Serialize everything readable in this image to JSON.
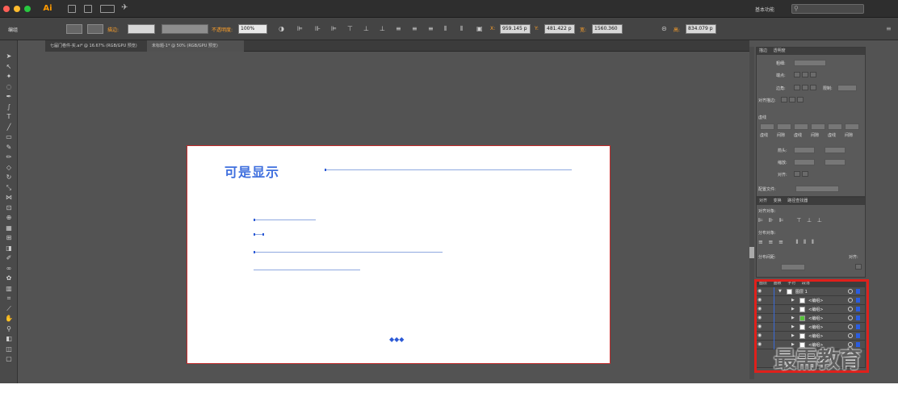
{
  "app": {
    "logo": "Ai",
    "workspace": "基本功能",
    "accent": "#ff9a00"
  },
  "controlbar": {
    "object_type": "编组",
    "stroke_label": "描边:",
    "opacity_label": "不透明度:",
    "opacity_value": "100%",
    "x_label": "X:",
    "x_value": "959.145 p",
    "y_label": "Y:",
    "y_value": "481.422 p",
    "w_label": "宽:",
    "w_value": "1560.360",
    "h_label": "高:",
    "h_value": "834.079 p"
  },
  "tabs": [
    {
      "label": "七届门卷件-实.ai* @ 16.67% (RGB/GPU 预览)"
    },
    {
      "label": "未标题-1* @ 50% (RGB/GPU 预览)"
    }
  ],
  "artboard": {
    "title": "可是显示",
    "dots": "◆◆◆",
    "border_color": "#c32b2b",
    "guide_color": "#8fa9e0"
  },
  "stroke_panel": {
    "tabs": [
      "描边",
      "透明度"
    ],
    "weight_label": "粗细:",
    "cap_label": "端点:",
    "corner_label": "边角:",
    "limit_label": "限制:",
    "align_label": "对齐描边:",
    "dashed_label": "虚线",
    "dash_fields": [
      "虚线",
      "间隙",
      "虚线",
      "间隙",
      "虚线",
      "间隙"
    ],
    "arrow_label": "箭头:",
    "scale_label": "缩放:",
    "align2_label": "对齐:",
    "profile_label": "配置文件:"
  },
  "align_panel": {
    "tabs": [
      "对齐",
      "变换",
      "路径查找器"
    ],
    "align_objects": "对齐对象:",
    "distribute_objects": "分布对象:",
    "distribute_spacing": "分布间距:",
    "align_to": "对齐:"
  },
  "layers_panel": {
    "tabs": [
      "图层",
      "画板",
      "字符",
      "段落"
    ],
    "rows": [
      {
        "name": "图层 1",
        "swatch": "#ffffff",
        "expanded": true
      },
      {
        "name": "<编组>",
        "swatch": "#ffffff"
      },
      {
        "name": "<编组>",
        "swatch": "#ffffff"
      },
      {
        "name": "<编组>",
        "swatch": "#57c23a"
      },
      {
        "name": "<编组>",
        "swatch": "#ffffff"
      },
      {
        "name": "<编组>",
        "swatch": "#ffffff"
      },
      {
        "name": "<编组>",
        "swatch": "#ffffff"
      }
    ],
    "highlight_color": "#e0201b"
  },
  "watermark": "最需教育"
}
